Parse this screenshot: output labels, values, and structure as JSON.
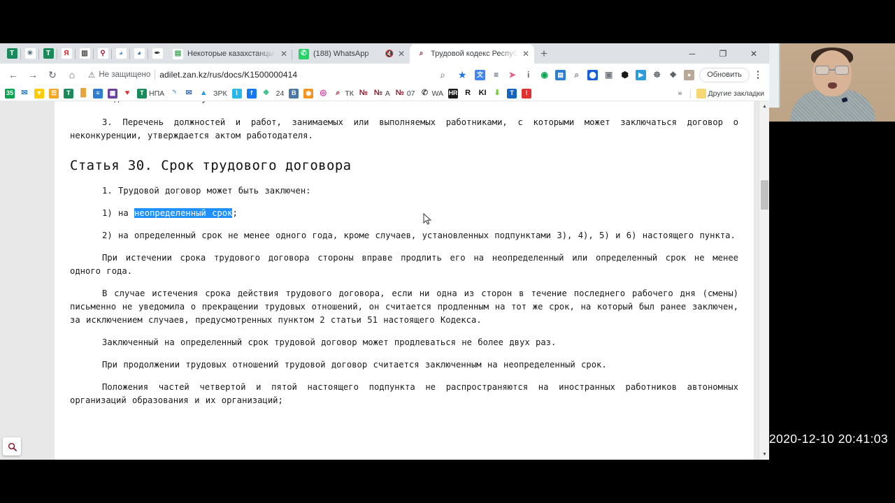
{
  "browser": {
    "pinned_tabs": [
      {
        "name": "pinned-tab-1",
        "glyph": "T",
        "bg": "#1b8a5a"
      },
      {
        "name": "pinned-tab-2",
        "glyph": "✳",
        "bg": "#ffffff",
        "fg": "#4a6b7c"
      },
      {
        "name": "pinned-tab-3",
        "glyph": "T",
        "bg": "#1b8a5a"
      },
      {
        "name": "pinned-tab-4",
        "glyph": "Я",
        "bg": "#ffffff",
        "fg": "#e01a1a"
      },
      {
        "name": "pinned-tab-5",
        "glyph": "▥",
        "bg": "#ffffff",
        "fg": "#444"
      },
      {
        "name": "pinned-tab-6",
        "glyph": "⚲",
        "bg": "#ffffff",
        "fg": "#9c1331"
      },
      {
        "name": "pinned-tab-7",
        "glyph": "◕",
        "bg": "#ffffff",
        "fg": "#5b9bd5"
      },
      {
        "name": "pinned-tab-8",
        "glyph": "◕",
        "bg": "#ffffff",
        "fg": "#3d6fa8"
      },
      {
        "name": "pinned-tab-9",
        "glyph": "✒",
        "bg": "#ffffff",
        "fg": "#333"
      }
    ],
    "tabs": [
      {
        "title": "Некоторые казахстанцы не смо",
        "active": false,
        "muted": false,
        "fav_glyph": "▤",
        "fav_bg": "#ffffff",
        "fav_fg": "#3aa757"
      },
      {
        "title": "(188) WhatsApp",
        "active": false,
        "muted": true,
        "fav_glyph": "✆",
        "fav_bg": "#25d366",
        "fav_fg": "#ffffff"
      },
      {
        "title": "Трудовой кодекс Республики К",
        "active": true,
        "muted": false,
        "fav_glyph": "⌕",
        "fav_bg": "#ffffff",
        "fav_fg": "#9c1331"
      }
    ],
    "new_tab_label": "+",
    "window_controls": {
      "minimize": "─",
      "maximize": "❐",
      "close": "✕"
    },
    "nav": {
      "back": "←",
      "forward": "→",
      "reload": "↻",
      "home": "⌂"
    },
    "omnibox": {
      "security_icon": "⚠",
      "security_label": "Не защищено",
      "url": "adilet.zan.kz/rus/docs/K1500000414",
      "zoom_icon": "⌕",
      "bookmark_icon": "★"
    },
    "extensions": [
      {
        "name": "translate-extension",
        "glyph": "文",
        "bg": "#4285f4",
        "fg": "#ffffff"
      },
      {
        "name": "layers-extension",
        "glyph": "≡",
        "bg": "#ffffff",
        "fg": "#2b3a55"
      },
      {
        "name": "arrow-extension",
        "glyph": "➤",
        "bg": "#ffffff",
        "fg": "#e8607f"
      },
      {
        "name": "info-extension",
        "glyph": "i",
        "bg": "#ffffff",
        "fg": "#5f6368"
      },
      {
        "name": "record-extension",
        "glyph": "◉",
        "bg": "#ffffff",
        "fg": "#0aa34f"
      },
      {
        "name": "id-card-extension",
        "glyph": "▤",
        "bg": "#2d7dd2",
        "fg": "#ffffff"
      },
      {
        "name": "search-extension",
        "glyph": "⌕",
        "bg": "#ffffff",
        "fg": "#7a7f85"
      },
      {
        "name": "bitwarden-extension",
        "glyph": "⬤",
        "bg": "#175ddc",
        "fg": "#ffffff"
      },
      {
        "name": "image-extension",
        "glyph": "▣",
        "bg": "#ffffff",
        "fg": "#767b80"
      },
      {
        "name": "box-extension",
        "glyph": "⬢",
        "bg": "#ffffff",
        "fg": "#1a1a1a"
      },
      {
        "name": "video-extension",
        "glyph": "▶",
        "bg": "#2d9cdb",
        "fg": "#ffffff"
      },
      {
        "name": "globe-extension",
        "glyph": "☸",
        "bg": "#ffffff",
        "fg": "#6b6f73"
      },
      {
        "name": "puzzle-extension",
        "glyph": "❖",
        "bg": "#ffffff",
        "fg": "#5f6368"
      },
      {
        "name": "profile-avatar",
        "glyph": "●",
        "bg": "#b9a898",
        "fg": "#ffffff"
      }
    ],
    "update_button": "Обновить",
    "bookmarks": [
      {
        "label": "",
        "glyph": "35",
        "bg": "#0aa34f",
        "fg": "#ffffff"
      },
      {
        "label": "",
        "glyph": "✉",
        "bg": "#ffffff",
        "fg": "#2d7dd2"
      },
      {
        "label": "",
        "glyph": "▼",
        "bg": "#ffcc00",
        "fg": "#ffffff"
      },
      {
        "label": "",
        "glyph": "☰",
        "bg": "#f5a623",
        "fg": "#ffffff"
      },
      {
        "label": "",
        "glyph": "T",
        "bg": "#1b8a5a",
        "fg": "#ffffff"
      },
      {
        "label": "",
        "glyph": "█",
        "bg": "#ffffff",
        "fg": "#e8a33d"
      },
      {
        "label": "",
        "glyph": "≡",
        "bg": "#2d7dd2",
        "fg": "#ffffff"
      },
      {
        "label": "",
        "glyph": "▦",
        "bg": "#6b3fa0",
        "fg": "#ffffff"
      },
      {
        "label": "",
        "glyph": "♥",
        "bg": "#ffffff",
        "fg": "#e03030"
      },
      {
        "label": "НПА",
        "glyph": "T",
        "bg": "#1b8a5a",
        "fg": "#ffffff"
      },
      {
        "label": "",
        "glyph": "◝",
        "bg": "#ffffff",
        "fg": "#2d7dd2"
      },
      {
        "label": "",
        "glyph": "✉",
        "bg": "#ffffff",
        "fg": "#3b6fb6"
      },
      {
        "label": "",
        "glyph": "▲",
        "bg": "#ffffff",
        "fg": "#2d9cdb"
      },
      {
        "label": "ЗРК",
        "glyph": "",
        "bg": "transparent",
        "fg": "#3c4043"
      },
      {
        "label": "",
        "glyph": "⌇",
        "bg": "#29b6e8",
        "fg": "#ffffff"
      },
      {
        "label": "",
        "glyph": "f",
        "bg": "#1877f2",
        "fg": "#ffffff"
      },
      {
        "label": "",
        "glyph": "❖",
        "bg": "#ffffff",
        "fg": "#3ec28f"
      },
      {
        "label": "24",
        "glyph": "",
        "bg": "transparent",
        "fg": "#3c4043"
      },
      {
        "label": "",
        "glyph": "B",
        "bg": "#4a76a8",
        "fg": "#ffffff"
      },
      {
        "label": "",
        "glyph": "◉",
        "bg": "#f7941e",
        "fg": "#ffffff"
      },
      {
        "label": "",
        "glyph": "◎",
        "bg": "#ffffff",
        "fg": "#d6249f"
      },
      {
        "label": "ТК",
        "glyph": "⌕",
        "bg": "#ffffff",
        "fg": "#9c1331"
      },
      {
        "label": "",
        "glyph": "№",
        "bg": "#ffffff",
        "fg": "#8b1c2b"
      },
      {
        "label": "А",
        "glyph": "№",
        "bg": "#ffffff",
        "fg": "#8b1c2b"
      },
      {
        "label": "07",
        "glyph": "№",
        "bg": "#ffffff",
        "fg": "#8b1c2b"
      },
      {
        "label": "WA",
        "glyph": "✆",
        "bg": "#ffffff",
        "fg": "#4b4b4b"
      },
      {
        "label": "",
        "glyph": "HR",
        "bg": "#1a1a1a",
        "fg": "#ffffff"
      },
      {
        "label": "",
        "glyph": "R",
        "bg": "#ffffff",
        "fg": "#111111"
      },
      {
        "label": "",
        "glyph": "KІ",
        "bg": "#ffffff",
        "fg": "#111111"
      },
      {
        "label": "",
        "glyph": "⬇",
        "bg": "#ffffff",
        "fg": "#7ac943"
      },
      {
        "label": "",
        "glyph": "T",
        "bg": "#1565c0",
        "fg": "#ffffff"
      },
      {
        "label": "",
        "glyph": "!",
        "bg": "#e03030",
        "fg": "#ffffff"
      }
    ],
    "bookmarks_overflow": "»",
    "other_bookmarks": "Другие закладки",
    "find_icon": "⌕"
  },
  "document": {
    "cut_line": "законодательством Республики Казахстан.",
    "paragraph_3": "3. Перечень должностей и работ, занимаемых или выполняемых работниками, с которыми может заключаться договор о неконкуренции, утверждается актом работодателя.",
    "article_heading": "Статья 30. Срок трудового договора",
    "item_1": "1. Трудовой договор может быть заключен:",
    "sub_1_prefix": "1) на ",
    "sub_1_highlight": "неопределенный срок",
    "sub_1_suffix": ";",
    "sub_2": "2) на определенный срок не менее одного года, кроме случаев, установленных подпунктами 3), 4), 5) и 6) настоящего пункта.",
    "para_extend": "При истечении срока трудового договора стороны вправе продлить его на неопределенный или определенный срок не менее одного года.",
    "para_expire": "В случае истечения срока действия трудового договора, если ни одна из сторон в течение последнего рабочего дня (смены) письменно не уведомила о прекращении трудовых отношений, он считается продленным на тот же срок, на который был ранее заключен, за исключением случаев, предусмотренных пунктом 2 статьи 51 настоящего Кодекса.",
    "para_twice": "Заключенный на определенный срок трудовой договор может продлеваться не более двух раз.",
    "para_continue": "При продолжении трудовых отношений трудовой договор считается заключенным на неопределенный срок.",
    "para_foreign": "Положения частей четвертой и пятой настоящего подпункта не распространяются на иностранных работников автономных организаций образования и их организаций;"
  },
  "overlay": {
    "timestamp": "2020-12-10 20:41:03"
  },
  "colors": {
    "selection_blue": "#1e90ff",
    "tab_strip": "#dee1e6",
    "page_bg": "#e8e8e8"
  }
}
